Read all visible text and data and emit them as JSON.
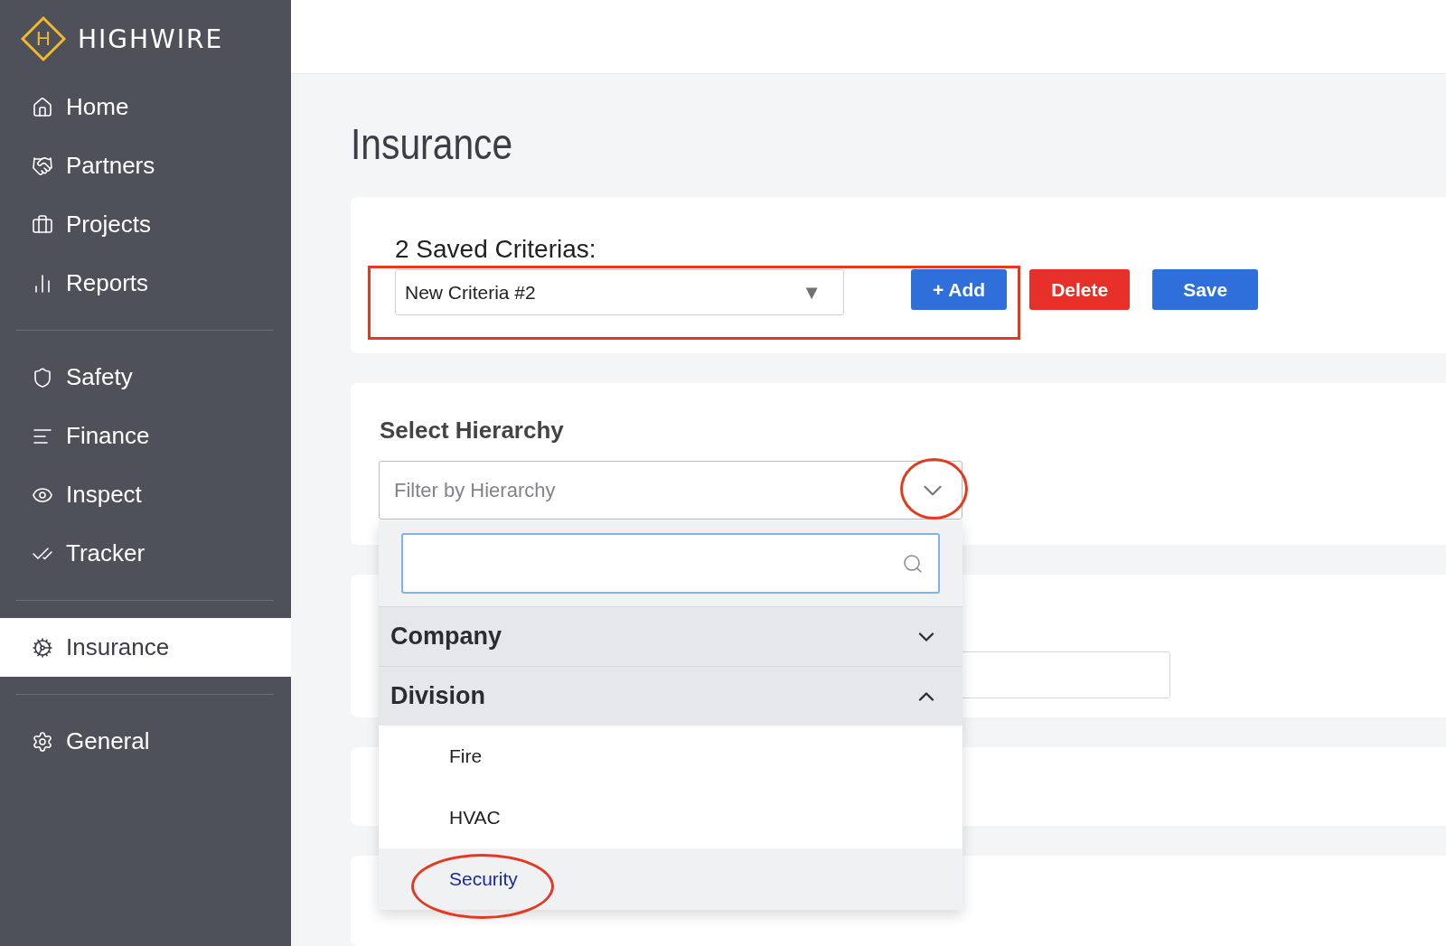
{
  "sidebar": {
    "logo": {
      "letter": "H",
      "name": "HIGHWIRE"
    },
    "groups": [
      [
        {
          "label": "Home",
          "selected": false
        },
        {
          "label": "Partners",
          "selected": false
        },
        {
          "label": "Projects",
          "selected": false
        },
        {
          "label": "Reports",
          "selected": false
        }
      ],
      [
        {
          "label": "Safety",
          "selected": false
        },
        {
          "label": "Finance",
          "selected": false
        },
        {
          "label": "Inspect",
          "selected": false
        },
        {
          "label": "Tracker",
          "selected": false
        }
      ],
      [
        {
          "label": "Insurance",
          "selected": true
        }
      ],
      [
        {
          "label": "General",
          "selected": false
        }
      ]
    ]
  },
  "page": {
    "title": "Insurance"
  },
  "criteria": {
    "heading": "2 Saved Criterias:",
    "value": "New Criteria #2",
    "caret": "▼",
    "buttons": [
      {
        "label": "+ Add",
        "kind": "primary"
      },
      {
        "label": "Delete",
        "kind": "danger"
      },
      {
        "label": "Save",
        "kind": "primary"
      }
    ]
  },
  "hierarchy": {
    "heading": "Select Hierarchy",
    "placeholder": "Filter by Hierarchy",
    "open": true,
    "groups": [
      {
        "label": "Company",
        "expanded": false
      },
      {
        "label": "Division",
        "expanded": true,
        "children": [
          {
            "label": "Fire",
            "selected": false
          },
          {
            "label": "HVAC",
            "selected": false
          },
          {
            "label": "Security",
            "selected": true
          }
        ]
      }
    ]
  }
}
